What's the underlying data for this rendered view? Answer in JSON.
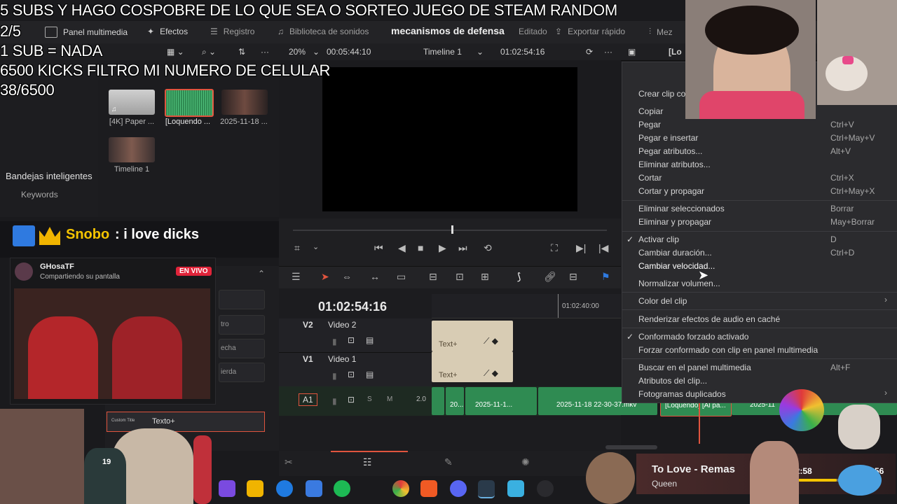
{
  "overlay": {
    "line1": "5 SUBS Y HAGO COSPOBRE DE LO QUE SEA O SORTEO JUEGO DE STEAM RANDOM",
    "line2": "2/5",
    "line3": "1 SUB = NADA",
    "line4": "6500 KICKS FILTRO MI NUMERO DE CELULAR",
    "line5": "38/6500"
  },
  "topbar": {
    "media_pool": "Panel multimedia",
    "effects": "Efectos",
    "log": "Registro",
    "sound_library": "Biblioteca de sonidos",
    "project": "mecanismos de defensa",
    "edited": "Editado",
    "quick_export": "Exportar rápido",
    "mezcla": "Mez"
  },
  "secbar": {
    "zoom": "20%",
    "duration": "00:05:44:10",
    "timeline": "Timeline 1",
    "timecode": "01:02:54:16",
    "loc": "[Lo"
  },
  "pool": {
    "clips": [
      {
        "label": "[4K] Paper ..."
      },
      {
        "label": "[Loquendo ..."
      },
      {
        "label": "2025-11-18 ..."
      },
      {
        "label": "Timeline 1"
      }
    ]
  },
  "leftpanel": {
    "smart_bins": "Bandejas inteligentes",
    "keywords": "Keywords"
  },
  "timeline": {
    "timecode": "01:02:54:16",
    "ruler_tc": "01:02:40:00",
    "v2_id": "V2",
    "v2_name": "Video 2",
    "v1_id": "V1",
    "v1_name": "Video 1",
    "a1_id": "A1",
    "a1_s": "S",
    "a1_m": "M",
    "a1_ch": "2.0",
    "title_clip": "Text+",
    "audio_clips": [
      "20...",
      "2025-11-1...",
      "2025-11-18 22-30-37.mkv",
      "[Loquendo] [Al pa...",
      "2025-11"
    ]
  },
  "inspector": {
    "row1": "tro",
    "row2": "echa",
    "row3": "ierda",
    "custom_title": "Custom Title",
    "custom_title_name": "Texto+"
  },
  "context_menu": {
    "items": [
      {
        "label": "Crear clip co",
        "shortcut": ""
      },
      {
        "label": "Copiar",
        "shortcut": ""
      },
      {
        "label": "Pegar",
        "shortcut": "Ctrl+V"
      },
      {
        "label": "Pegar e insertar",
        "shortcut": "Ctrl+May+V"
      },
      {
        "label": "Pegar atributos...",
        "shortcut": "Alt+V"
      },
      {
        "label": "Eliminar atributos...",
        "shortcut": ""
      },
      {
        "label": "Cortar",
        "shortcut": "Ctrl+X"
      },
      {
        "label": "Cortar y propagar",
        "shortcut": "Ctrl+May+X"
      },
      {
        "label": "Eliminar seleccionados",
        "shortcut": "Borrar"
      },
      {
        "label": "Eliminar y propagar",
        "shortcut": "May+Borrar"
      },
      {
        "label": "Activar clip",
        "shortcut": "D"
      },
      {
        "label": "Cambiar duración...",
        "shortcut": "Ctrl+D"
      },
      {
        "label": "Cambiar velocidad...",
        "shortcut": ""
      },
      {
        "label": "Normalizar volumen...",
        "shortcut": ""
      },
      {
        "label": "Color del clip",
        "shortcut": ""
      },
      {
        "label": "Renderizar efectos de audio en caché",
        "shortcut": ""
      },
      {
        "label": "Conformado forzado activado",
        "shortcut": ""
      },
      {
        "label": "Forzar conformado con clip en panel multimedia",
        "shortcut": ""
      },
      {
        "label": "Buscar en el panel multimedia",
        "shortcut": "Alt+F"
      },
      {
        "label": "Atributos del clip...",
        "shortcut": ""
      },
      {
        "label": "Fotogramas duplicados",
        "shortcut": ""
      }
    ]
  },
  "chat": {
    "user": "Snobo",
    "message": ": i love dicks"
  },
  "live": {
    "user": "GHosaTF",
    "status": "Compartiendo su pantalla",
    "badge": "EN VIVO"
  },
  "music": {
    "title": "To Love - Remas",
    "artist": "Queen",
    "time": "02:58",
    "time_end": "56"
  },
  "misc": {
    "sticker_num": "19"
  }
}
